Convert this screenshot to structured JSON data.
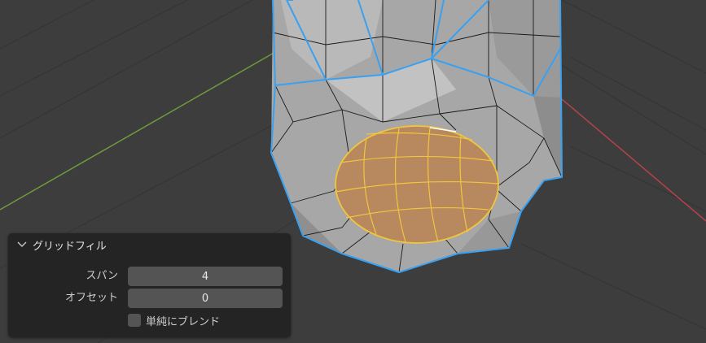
{
  "colors": {
    "background": "#3d3d3d",
    "grid_line": "#353535",
    "axis_x": "#b5424a",
    "axis_y": "#6f9a3c",
    "mesh_face": "#a9a9a9",
    "mesh_edge": "#1a1a1a",
    "boundary_edge": "#3aa0f0",
    "selected_face": "#b8895e",
    "selected_edge": "#f2c53d",
    "panel_bg": "#242424",
    "field_bg": "#545454"
  },
  "operator_panel": {
    "title": "グリッドフィル",
    "collapse_icon": "chevron-down-icon",
    "span": {
      "label": "スパン",
      "value": "4"
    },
    "offset": {
      "label": "オフセット",
      "value": "0"
    },
    "simple_blend": {
      "label": "単純にブレンド",
      "checked": false
    }
  }
}
